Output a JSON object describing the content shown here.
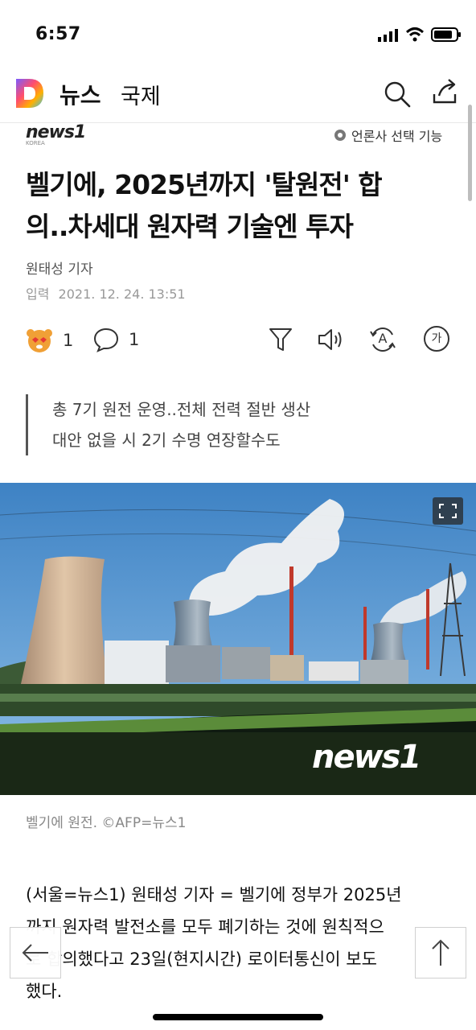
{
  "status_bar": {
    "time": "6:57"
  },
  "header": {
    "title": "뉴스",
    "section": "국제"
  },
  "press": {
    "name": "news1",
    "sub": "KOREA",
    "select_label": "언론사 선택 기능"
  },
  "article": {
    "headline_line1": "벨기에, 2025년까지 '탈원전' 합",
    "headline_line2": "의..차세대 원자력 기술엔 투자",
    "reporter": "원태성 기자",
    "date_label": "입력",
    "date": "2021. 12. 24. 13:51",
    "reaction_count": "1",
    "comment_count": "1",
    "summary": [
      "총 7기 원전 운영..전체 전력 절반 생산",
      "대안 없을 시 2기 수명 연장할수도"
    ],
    "photo_watermark": "news1",
    "caption": "벨기에 원전. ©AFP=뉴스1",
    "body_lines": [
      "(서울=뉴스1) 원태성 기자 = 벨기에 정부가 2025년",
      "까지 원자력 발전소를 모두 폐기하는 것에 원칙적으",
      "로 합의했다고  23일(현지시간)  로이터통신이  보도",
      "했다."
    ]
  },
  "toolbar": {
    "font_label": "가",
    "translate_label": "A"
  },
  "colors": {
    "accent_orange": "#F26522",
    "text_dark": "#111111",
    "muted": "#999999"
  }
}
